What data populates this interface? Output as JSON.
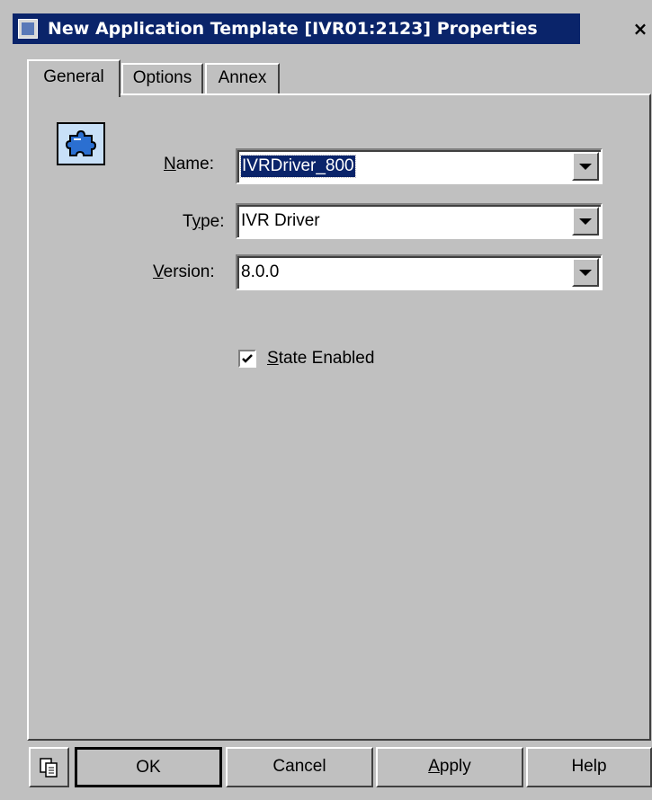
{
  "window": {
    "title": "New Application Template [IVR01:2123] Properties",
    "close_label": "×"
  },
  "tabs": [
    {
      "label": "General",
      "active": true
    },
    {
      "label": "Options",
      "active": false
    },
    {
      "label": "Annex",
      "active": false
    }
  ],
  "fields": {
    "name": {
      "label_pre": "",
      "label_mn": "N",
      "label_post": "ame:",
      "value": "IVRDriver_800"
    },
    "type": {
      "label_pre": "T",
      "label_mn": "y",
      "label_post": "pe:",
      "value": "IVR Driver"
    },
    "version": {
      "label_pre": "",
      "label_mn": "V",
      "label_post": "ersion:",
      "value": "8.0.0"
    }
  },
  "state": {
    "checked": true,
    "label_mn": "S",
    "label_post": "tate Enabled"
  },
  "buttons": {
    "ok": "OK",
    "cancel": "Cancel",
    "apply_mn": "A",
    "apply_post": "pply",
    "help": "Help"
  },
  "icons": {
    "app": "application-template-icon",
    "object": "puzzle-piece-icon",
    "copy": "copy-icon",
    "check": "checkmark-icon"
  }
}
